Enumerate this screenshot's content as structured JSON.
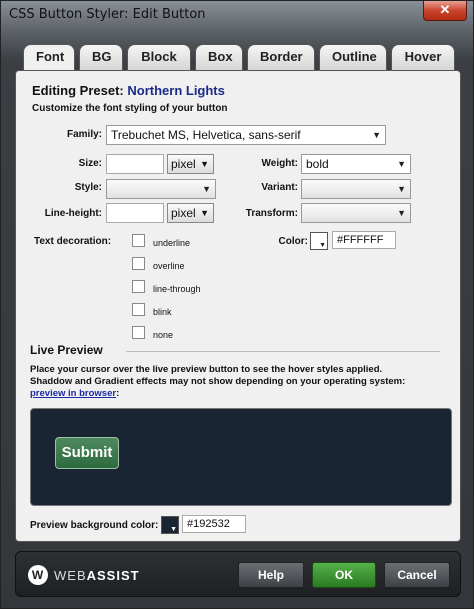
{
  "window": {
    "title": "CSS Button Styler: Edit Button",
    "close_glyph": "✕"
  },
  "tabs": [
    {
      "label": "Font",
      "active": true
    },
    {
      "label": "BG"
    },
    {
      "label": "Block"
    },
    {
      "label": "Box"
    },
    {
      "label": "Border"
    },
    {
      "label": "Outline"
    },
    {
      "label": "Hover"
    }
  ],
  "panel": {
    "preset_label": "Editing Preset:",
    "preset_name": "Northern Lights",
    "subtitle": "Customize the font styling of your button",
    "family": {
      "label": "Family:",
      "value": "Trebuchet MS, Helvetica, sans-serif"
    },
    "size": {
      "label": "Size:",
      "value": "",
      "unit": "pixel"
    },
    "weight": {
      "label": "Weight:",
      "value": "bold"
    },
    "style": {
      "label": "Style:",
      "value": ""
    },
    "variant": {
      "label": "Variant:",
      "value": ""
    },
    "line_height": {
      "label": "Line-height:",
      "value": "",
      "unit": "pixel"
    },
    "transform": {
      "label": "Transform:",
      "value": ""
    },
    "text_decoration": {
      "label": "Text decoration:",
      "options": [
        "underline",
        "overline",
        "line-through",
        "blink",
        "none"
      ]
    },
    "color": {
      "label": "Color:",
      "value": "#FFFFFF",
      "swatch": "#FFFFFF"
    }
  },
  "live_preview": {
    "heading": "Live Preview",
    "note1": "Place your cursor over the live preview button to see the hover styles applied.",
    "note2": "Shaddow and Gradient effects may not show depending on your operating system:",
    "link": "preview in browser",
    "submit_label": "Submit",
    "bg_label": "Preview background color:",
    "bg_value": "#192532",
    "bg_color": "#192532"
  },
  "footer": {
    "logo_web": "WEB",
    "logo_assist": "ASSIST",
    "help": "Help",
    "ok": "OK",
    "cancel": "Cancel"
  }
}
